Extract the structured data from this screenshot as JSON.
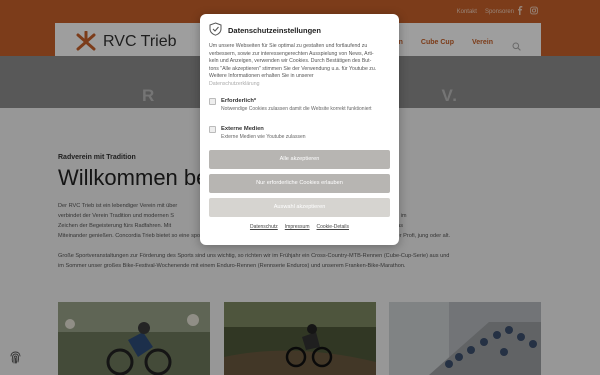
{
  "header": {
    "top_links": [
      "Kontakt",
      "Sponsoren"
    ],
    "logo_text": "RVC Trieb",
    "nav_items": [
      "...n",
      "Cube Cup",
      "Verein"
    ]
  },
  "hero": {
    "title": "R                                                  V."
  },
  "main": {
    "kicker": "Radverein mit Tradition",
    "heading": "Willkommen be",
    "para1_lines": [
      "Der RVC Trieb ist ein lebendiger Verein mit über                                                                           hat. Beheimatet in Trieb bei Lichtenfels,",
      "verbindet der Verein Tradition und modernen S                                                                              ielen Nachwuchsförderung steht hier alles im",
      "Zeichen der Begeisterung fürs Radfahren. Mit                                                                               nnehmen, ihre Leistung verbessern und das",
      "Miteinander genießen. Concordia Trieb bietet so eine sportliche Heimat für alle, die ihre Leidenschaft fürs Radeln teilen – ob Anfänger oder Profi, jung oder alt."
    ],
    "para2_lines": [
      "Große Sportveranstaltungen zur Förderung des Sports sind uns wichtig, so richten wir im Frühjahr ein Cross-Country-MTB-Rennen (Cube-Cup-Serie) aus und",
      "im Sommer unser großes Bike-Festival-Wochenende mit einem Enduro-Rennen (Rennserie Endurox) und unserem Franken-Bike-Marathon."
    ]
  },
  "consent": {
    "title": "Datenschutzeinstellungen",
    "body_lines": [
      "Um unsere Webseiten für Sie optimal zu gestalten und fortlaufend zu",
      "verbessern, sowie zur interessengerechten Ausspielung von News, Arti-",
      "keln und Anzeigen, verwenden wir Cookies. Durch Bestätigen des But-",
      "tons \"Alle akzeptieren\" stimmen Sie der Verwendung u.a. für Youtube zu.",
      "Weitere Informationen erhalten Sie in unserer"
    ],
    "privacy_link": "Datenschutzerklärung",
    "options": [
      {
        "title": "Erforderlich*",
        "desc": "Notwendige Cookies zulassen damit die Website korrekt funktioniert"
      },
      {
        "title": "Externe Medien",
        "desc": "Externe Medien wie Youtube zulassen"
      }
    ],
    "btn_accept_all": "Alle akzeptieren",
    "btn_required_only": "Nur erforderliche Cookies erlauben",
    "btn_accept_selection": "Auswahl akzeptieren",
    "footer_links": [
      "Datenschutz",
      "Impressum",
      "Cookie-Details"
    ]
  },
  "colors": {
    "brand": "#c8622a",
    "hero": "#8e8e8e"
  },
  "icons": [
    "logo-mark-icon",
    "facebook-icon",
    "instagram-icon",
    "search-icon",
    "shield-check-icon",
    "fingerprint-icon"
  ]
}
